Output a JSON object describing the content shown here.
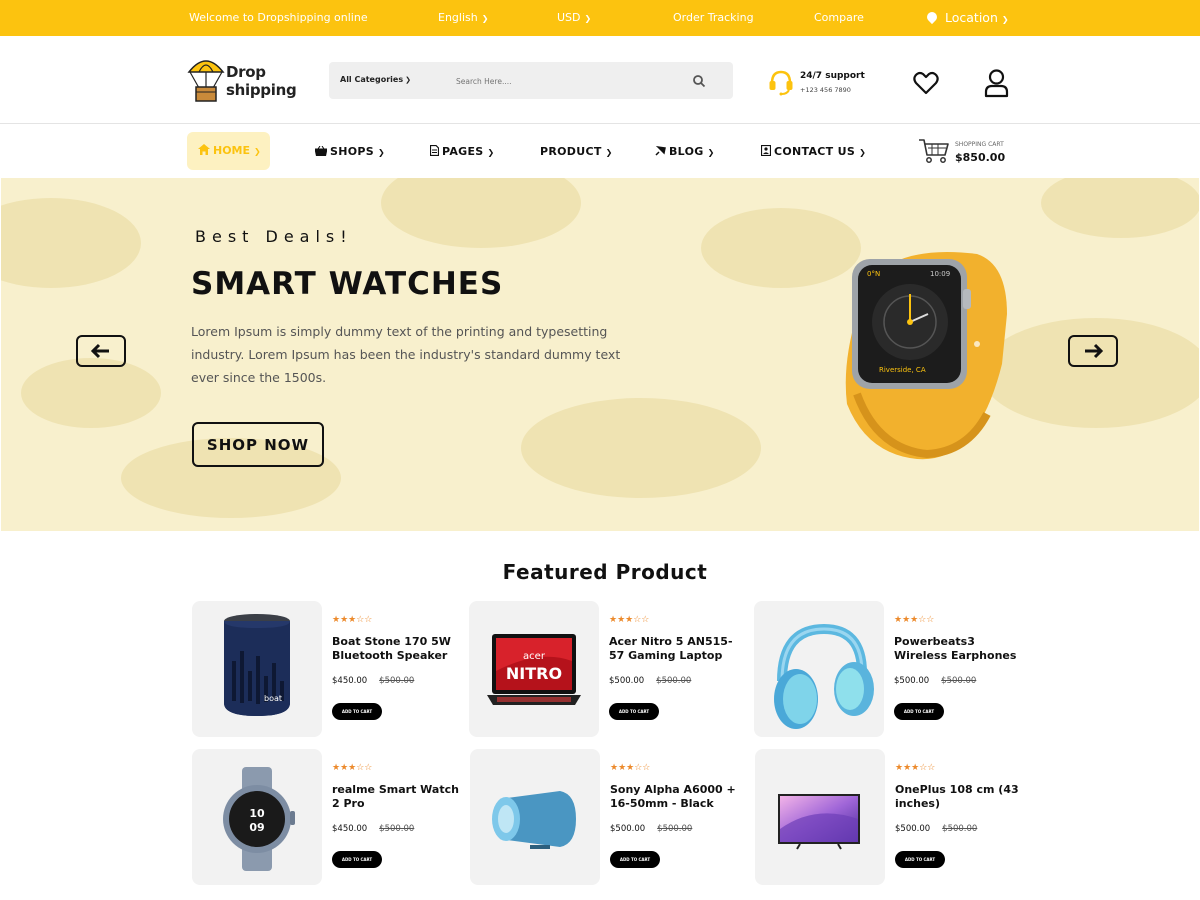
{
  "topbar": {
    "welcome": "Welcome to Dropshipping online",
    "language": "English",
    "currency": "USD",
    "order_tracking": "Order Tracking",
    "compare": "Compare",
    "location": "Location"
  },
  "header": {
    "logo_line1": "Drop",
    "logo_line2": "shipping",
    "search_category": "All Categories",
    "search_placeholder": "Search Here....",
    "support_title": "24/7 support",
    "support_phone": "+123 456 7890"
  },
  "nav": {
    "home": "HOME",
    "shops": "SHOPS",
    "pages": "PAGES",
    "product": "PRODUCT",
    "blog": "BLOG",
    "contact": "CONTACT US",
    "cart_label": "SHOPPING CART",
    "cart_total": "$850.00"
  },
  "hero": {
    "eyebrow": "Best Deals!",
    "title": "SMART WATCHES",
    "description": "Lorem Ipsum is simply dummy text of the printing and typesetting  industry. Lorem Ipsum has been the industry's standard dummy text ever since the 1500s.",
    "cta": "SHOP NOW",
    "watch_location": "Riverside, CA"
  },
  "featured": {
    "title": "Featured Product",
    "products": [
      {
        "name": "Boat Stone 170 5W Bluetooth Speaker",
        "price": "$450.00",
        "old_price": "$500.00",
        "rating": 3,
        "button": "ADD TO CART"
      },
      {
        "name": "Acer Nitro 5 AN515-57 Gaming Laptop",
        "price": "$500.00",
        "old_price": "$500.00",
        "rating": 3,
        "button": "ADD TO CART"
      },
      {
        "name": "Powerbeats3 Wireless Earphones",
        "price": "$500.00",
        "old_price": "$500.00",
        "rating": 3,
        "button": "ADD TO CART"
      },
      {
        "name": "realme Smart Watch 2 Pro",
        "price": "$450.00",
        "old_price": "$500.00",
        "rating": 3,
        "button": "ADD TO CART"
      },
      {
        "name": "Sony Alpha A6000 + 16-50mm - Black",
        "price": "$500.00",
        "old_price": "$500.00",
        "rating": 3,
        "button": "ADD TO CART"
      },
      {
        "name": "OnePlus 108 cm (43 inches)",
        "price": "$500.00",
        "old_price": "$500.00",
        "rating": 3,
        "button": "ADD TO CART"
      }
    ]
  },
  "colors": {
    "accent": "#fcc30f",
    "hero_bg": "#f8f0cd",
    "star": "#ec8a2c"
  }
}
